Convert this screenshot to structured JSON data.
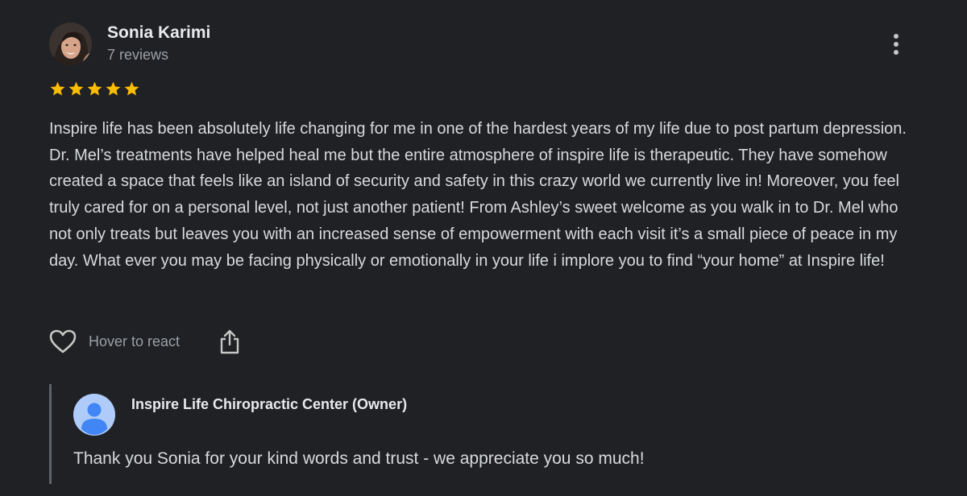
{
  "review": {
    "reviewer_name": "Sonia Karimi",
    "review_count": "7 reviews",
    "rating": 5,
    "rating_max": 5,
    "star_color": "#fbbc04",
    "text": "Inspire life has been absolutely life changing for me in one of the hardest years of my life due to post partum depression. Dr. Mel’s treatments have helped heal me but the entire atmosphere of inspire life is therapeutic. They have somehow created a space that feels like an island of security and safety in this crazy world we currently live in! Moreover, you feel truly cared for on a personal level, not just another patient! From Ashley’s sweet welcome as you walk in to Dr. Mel who not only treats but leaves you with an increased sense of empowerment with each visit it’s a small piece of peace in my day. What ever you may be facing physically or emotionally in your life i implore you to find “your home” at Inspire life!"
  },
  "actions": {
    "react_label": "Hover to react",
    "heart_icon": "heart-outline-icon",
    "share_icon": "share-icon",
    "more_icon": "more-vert-icon"
  },
  "owner_reply": {
    "owner_name": "Inspire Life Chiropractic Center (Owner)",
    "text": "Thank you Sonia for your kind words and trust - we appreciate you so much!",
    "avatar_color": "#aecbfa",
    "avatar_icon": "person-icon"
  },
  "colors": {
    "background": "#202124",
    "primary_text": "#e8eaed",
    "secondary_text": "#9aa0a6"
  }
}
